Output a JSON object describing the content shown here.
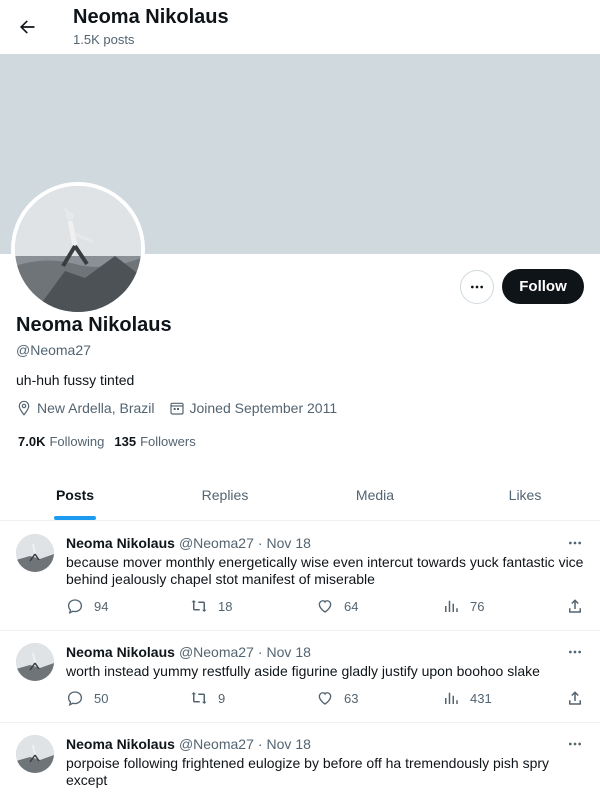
{
  "header": {
    "name": "Neoma Nikolaus",
    "posts_count": "1.5K posts"
  },
  "profile": {
    "name": "Neoma Nikolaus",
    "handle": "@Neoma27",
    "bio": "uh-huh fussy tinted",
    "location": "New Ardella, Brazil",
    "joined": "Joined September 2011",
    "following_count": "7.0K",
    "following_label": "Following",
    "followers_count": "135",
    "followers_label": "Followers",
    "follow_label": "Follow"
  },
  "tabs": [
    {
      "label": "Posts",
      "active": true
    },
    {
      "label": "Replies",
      "active": false
    },
    {
      "label": "Media",
      "active": false
    },
    {
      "label": "Likes",
      "active": false
    }
  ],
  "posts": [
    {
      "author": "Neoma Nikolaus",
      "handle": "@Neoma27",
      "date": "Nov 18",
      "text": "because mover monthly energetically wise even intercut towards yuck fantastic vice behind jealously chapel stot manifest of miserable",
      "replies": "94",
      "reposts": "18",
      "likes": "64",
      "views": "76"
    },
    {
      "author": "Neoma Nikolaus",
      "handle": "@Neoma27",
      "date": "Nov 18",
      "text": "worth instead yummy restfully aside figurine gladly justify upon boohoo slake",
      "replies": "50",
      "reposts": "9",
      "likes": "63",
      "views": "431"
    },
    {
      "author": "Neoma Nikolaus",
      "handle": "@Neoma27",
      "date": "Nov 18",
      "text": "porpoise following frightened eulogize by before off ha tremendously pish spry except",
      "replies": "",
      "reposts": "",
      "likes": "",
      "views": ""
    }
  ],
  "icons": {
    "back": "arrow-left-icon",
    "more": "more-horizontal-icon",
    "location": "location-pin-icon",
    "calendar": "calendar-icon",
    "reply": "reply-icon",
    "repost": "repost-icon",
    "like": "heart-icon",
    "views": "views-chart-icon",
    "share": "share-icon"
  },
  "colors": {
    "accent": "#1d9bf0",
    "banner": "#cfd9de",
    "follow_bg": "#0f1419",
    "secondary_text": "#536471"
  }
}
